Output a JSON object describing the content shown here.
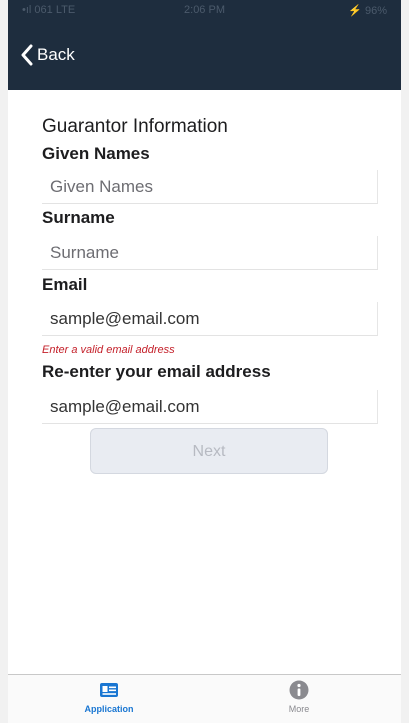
{
  "status_bar": {
    "carrier": "•ıl 061 LTE",
    "time": "2:06 PM",
    "battery": "⚡ 96%"
  },
  "nav": {
    "back_label": "Back"
  },
  "form": {
    "title": "Guarantor Information",
    "given_names": {
      "label": "Given Names",
      "placeholder": "Given Names",
      "value": ""
    },
    "surname": {
      "label": "Surname",
      "placeholder": "Surname",
      "value": ""
    },
    "email": {
      "label": "Email",
      "placeholder": "",
      "value": "sample@email.com",
      "error": "Enter a valid email address"
    },
    "confirm_email": {
      "label": "Re-enter your email address",
      "placeholder": "",
      "value": "sample@email.com"
    },
    "next_label": "Next"
  },
  "tab_bar": {
    "tabs": [
      {
        "label": "Application",
        "icon": "id-card-icon",
        "active": true
      },
      {
        "label": "More",
        "icon": "info-icon",
        "active": false
      }
    ]
  },
  "colors": {
    "nav_background": "#1e2d3e",
    "error": "#c4202a",
    "active_tab": "#1976d2",
    "inactive_tab": "#8a8a8f",
    "disabled_button": "#e9ecf2"
  }
}
